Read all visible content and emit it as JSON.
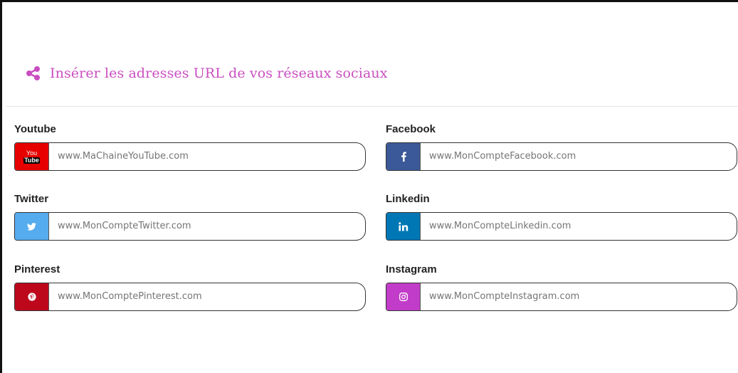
{
  "header": {
    "title": "Insérer les adresses URL de vos réseaux sociaux",
    "icon": "share-icon",
    "title_color": "#c94ec0"
  },
  "fields": {
    "youtube": {
      "label": "Youtube",
      "placeholder": "www.MaChaineYouTube.com",
      "badge_color": "#e60000",
      "icon": "youtube-icon",
      "icon_text_top": "You",
      "icon_text_bottom": "Tube"
    },
    "facebook": {
      "label": "Facebook",
      "placeholder": "www.MonCompteFacebook.com",
      "badge_color": "#3b5998",
      "icon": "facebook-icon"
    },
    "twitter": {
      "label": "Twitter",
      "placeholder": "www.MonCompteTwitter.com",
      "badge_color": "#55acee",
      "icon": "twitter-icon"
    },
    "linkedin": {
      "label": "Linkedin",
      "placeholder": "www.MonCompteLinkedin.com",
      "badge_color": "#0077b5",
      "icon": "linkedin-icon"
    },
    "pinterest": {
      "label": "Pinterest",
      "placeholder": "www.MonComptePinterest.com",
      "badge_color": "#bd081c",
      "icon": "pinterest-icon"
    },
    "instagram": {
      "label": "Instagram",
      "placeholder": "www.MonCompteInstagram.com",
      "badge_color": "#c13cc8",
      "icon": "instagram-icon"
    }
  }
}
